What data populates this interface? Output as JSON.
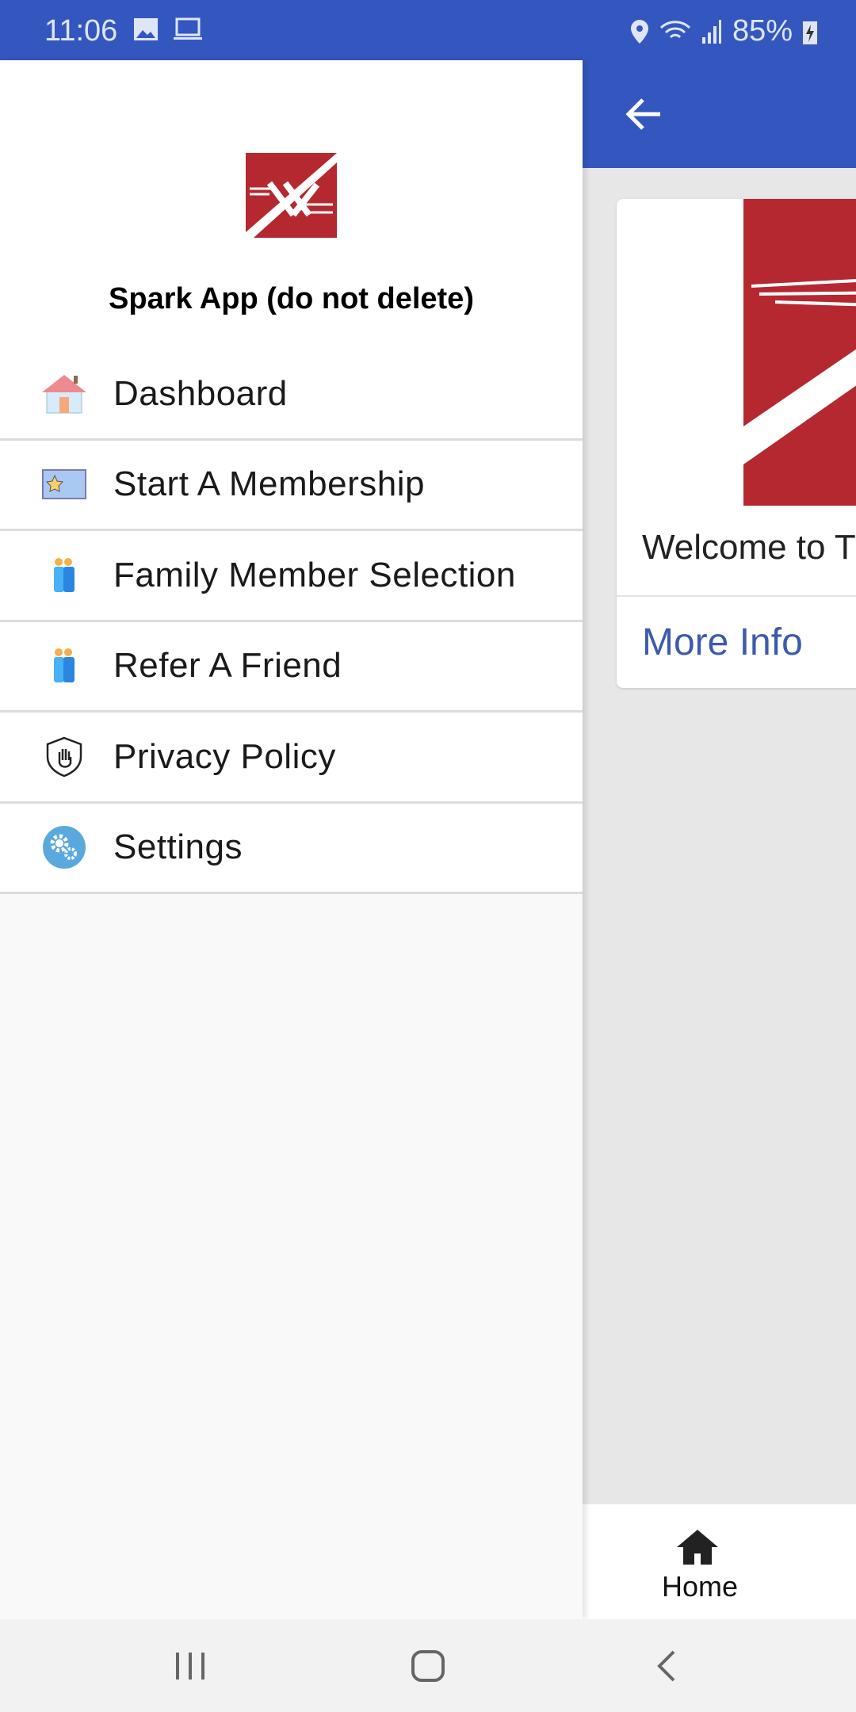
{
  "status_bar": {
    "time": "11:06",
    "battery": "85%"
  },
  "drawer": {
    "app_title": "Spark App (do not delete)",
    "items": [
      {
        "label": "Dashboard",
        "icon": "house-icon"
      },
      {
        "label": "Start A Membership",
        "icon": "membership-card-icon"
      },
      {
        "label": "Family Member Selection",
        "icon": "family-icon"
      },
      {
        "label": "Refer A Friend",
        "icon": "friends-icon"
      },
      {
        "label": "Privacy Policy",
        "icon": "shield-hand-icon"
      },
      {
        "label": "Settings",
        "icon": "gears-icon"
      }
    ]
  },
  "main": {
    "card": {
      "welcome": "Welcome to T",
      "more_info": "More Info"
    },
    "bottom_nav": {
      "home": "Home"
    }
  },
  "colors": {
    "primary": "#3457bf",
    "brand_red": "#b5282f",
    "link": "#3d5aaf"
  }
}
